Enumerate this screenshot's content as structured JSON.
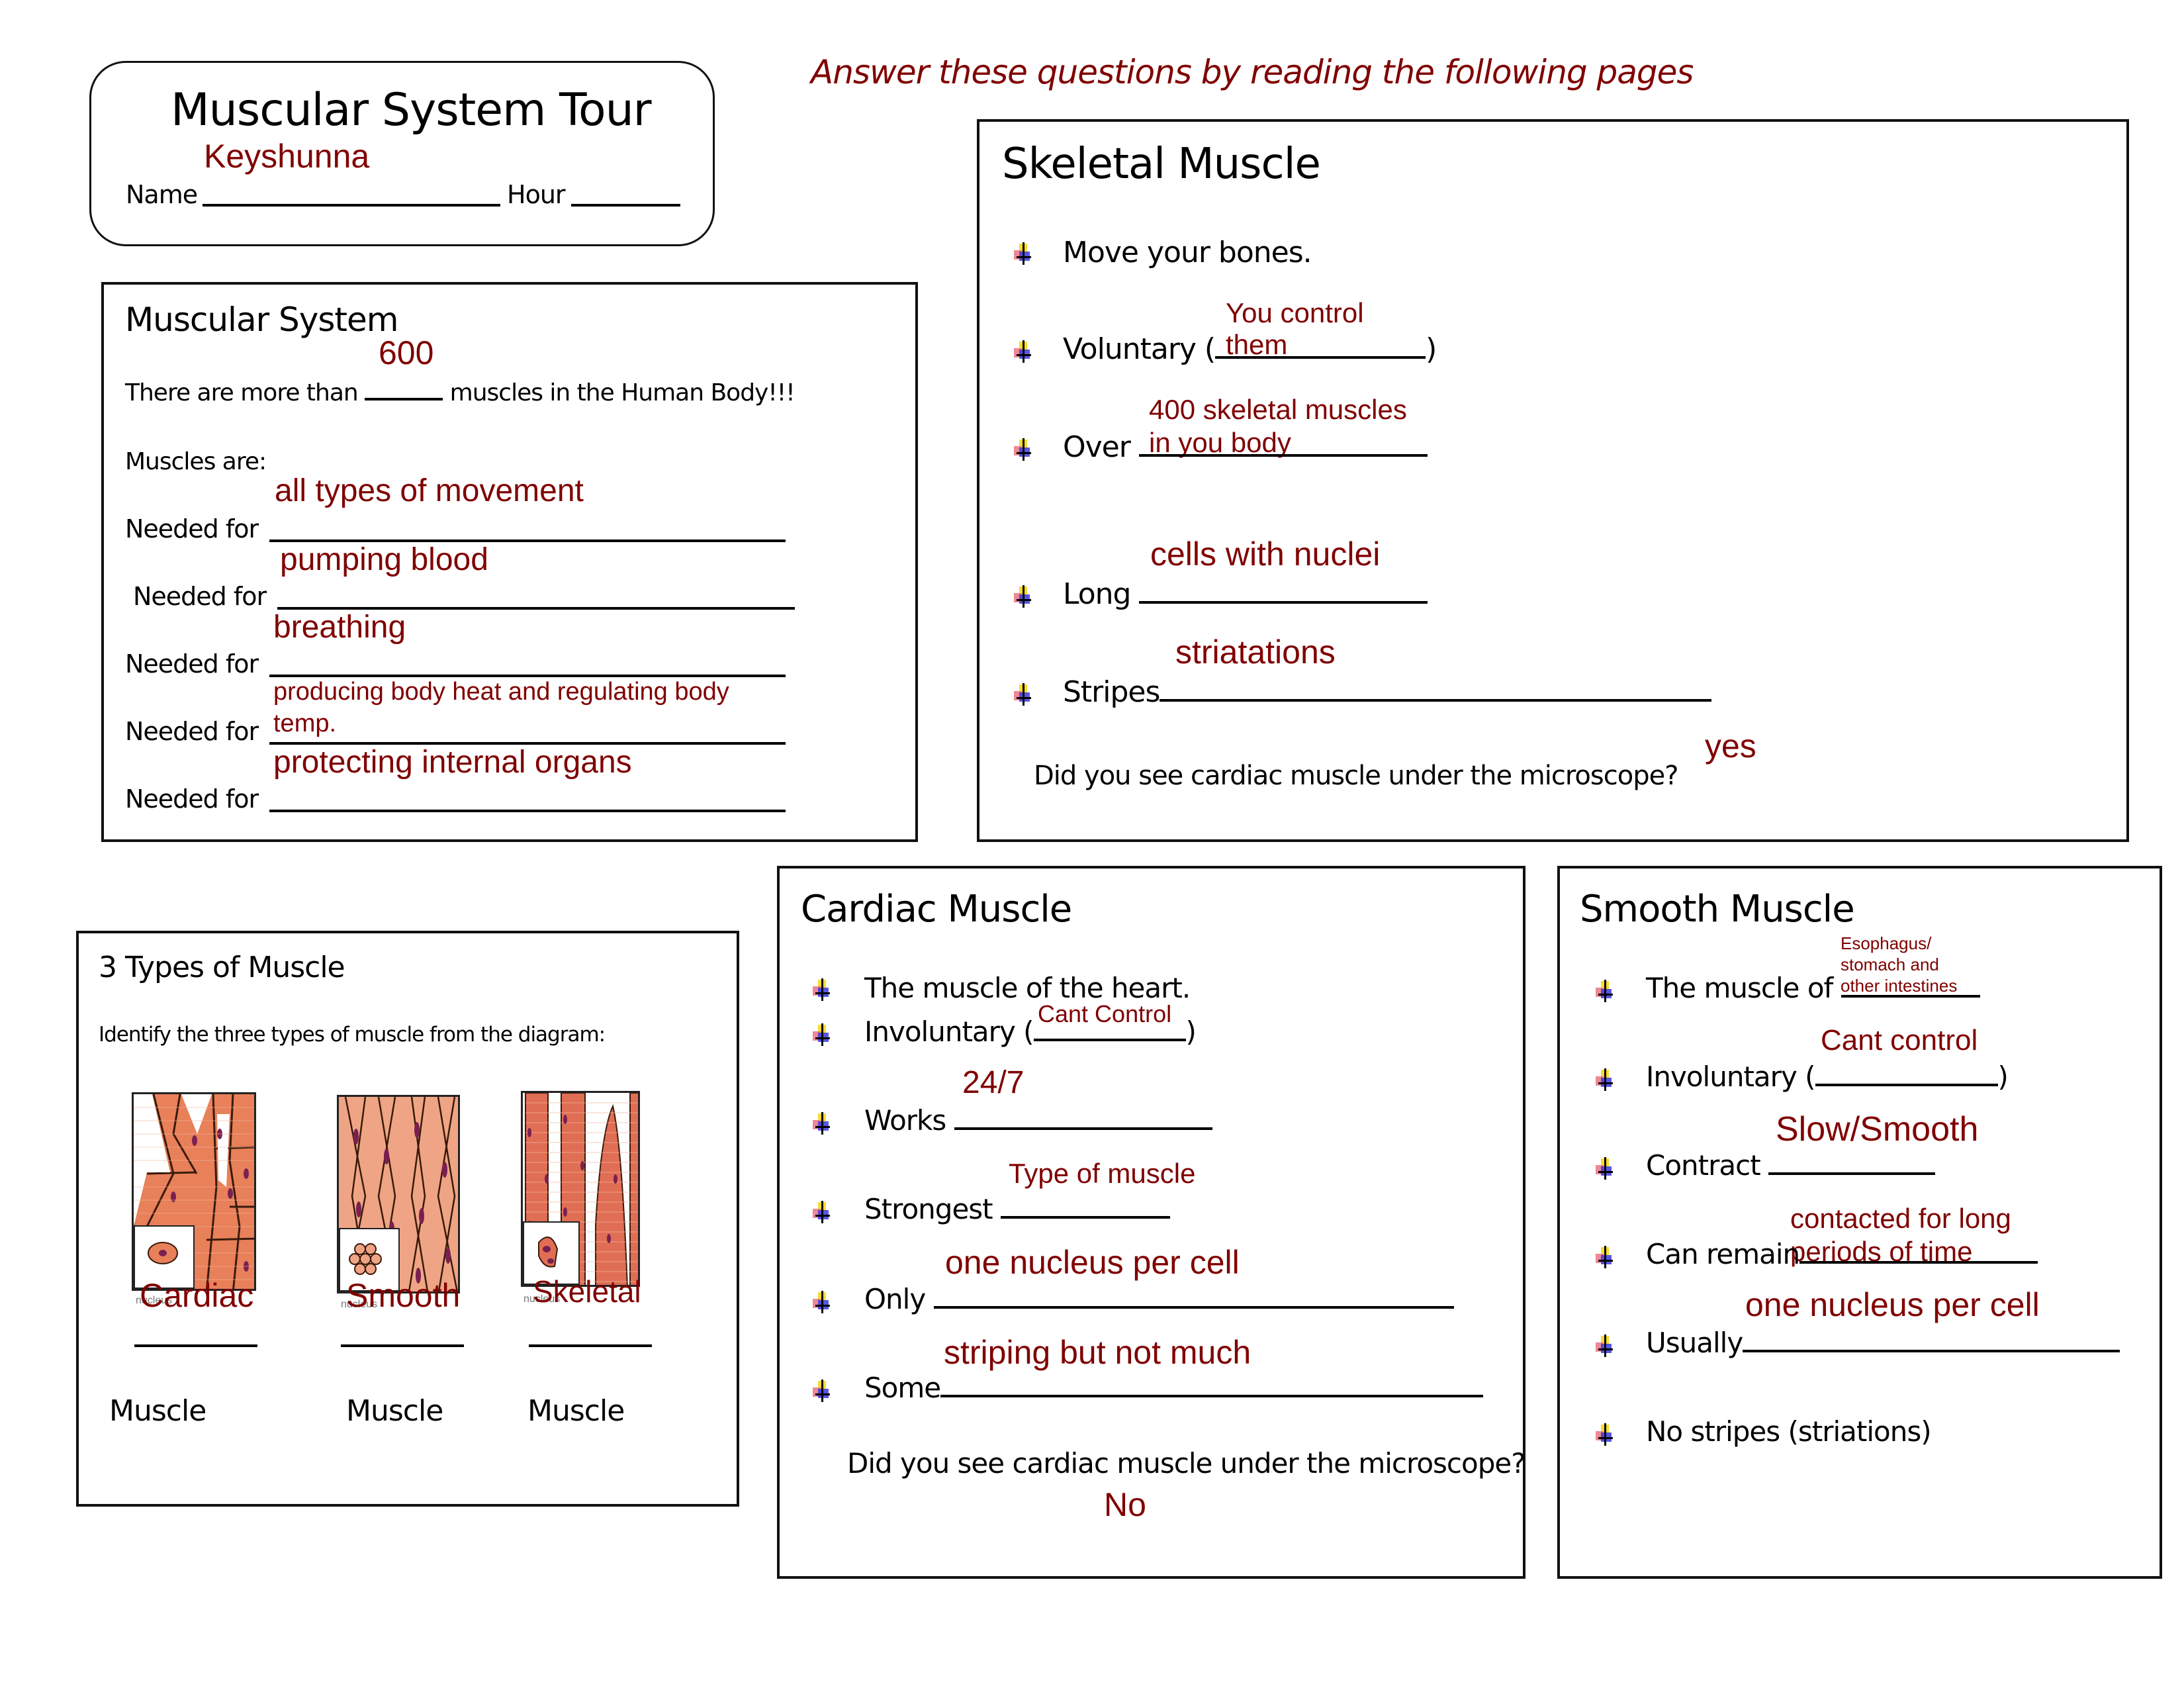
{
  "header": {
    "instruction": "Answer these questions by reading the following pages"
  },
  "title_box": {
    "title": "Muscular System Tour",
    "name_label": "Name",
    "name_value": "Keyshunna",
    "hour_label": "Hour",
    "hour_value": ""
  },
  "muscular_system": {
    "heading": "Muscular System",
    "count_prefix": "There are more than",
    "count_suffix": "muscles in the Human Body!!!",
    "count_answer": "600",
    "muscles_are_label": "Muscles are:",
    "needed_for_label": "Needed for",
    "needed_for": [
      {
        "answer": "all types of movement"
      },
      {
        "answer": "pumping blood"
      },
      {
        "answer": "breathing"
      },
      {
        "answer_line1": "producing body heat and regulating body",
        "answer_line2": "temp."
      },
      {
        "answer": "protecting internal organs"
      }
    ]
  },
  "skeletal": {
    "heading": "Skeletal Muscle",
    "items": [
      {
        "label": "Move your bones."
      },
      {
        "label": "Voluntary (",
        "suffix": ")",
        "answer_line1": "You control",
        "answer_line2": "them"
      },
      {
        "label": "Over",
        "answer_line1": "400 skeletal muscles",
        "answer_line2": "in you body"
      },
      {
        "label": "Long",
        "answer": "cells with nuclei"
      },
      {
        "label": "Stripes",
        "answer": "striatations"
      }
    ],
    "question": "Did you see cardiac muscle under the microscope?",
    "question_answer": "yes"
  },
  "three_types": {
    "heading": "3 Types of Muscle",
    "instruction": "Identify the three types of muscle from the diagram:",
    "inset_label": "nucleus",
    "types": [
      {
        "answer": "Cardiac",
        "suffix": "Muscle",
        "tissue_color": "#e8805a"
      },
      {
        "answer": "Smooth",
        "suffix": "Muscle",
        "tissue_color": "#efa585"
      },
      {
        "answer": "Skeletal",
        "suffix": "Muscle",
        "tissue_color": "#e06e55"
      }
    ]
  },
  "cardiac": {
    "heading": "Cardiac Muscle",
    "items": [
      {
        "label": "The muscle of the heart."
      },
      {
        "label": "Involuntary (",
        "suffix": ")",
        "answer": "Cant Control"
      },
      {
        "label": "Works",
        "answer": "24/7"
      },
      {
        "label": "Strongest",
        "answer": "Type of muscle"
      },
      {
        "label": "Only",
        "answer": "one nucleus per cell"
      },
      {
        "label": "Some",
        "answer": "striping but not much"
      }
    ],
    "question": "Did you see cardiac muscle under the microscope?",
    "question_answer": "No"
  },
  "smooth": {
    "heading": "Smooth Muscle",
    "items": [
      {
        "label": "The muscle of",
        "answer_line1": "Esophagus/",
        "answer_line2": "stomach and",
        "answer_line3": "other intestines"
      },
      {
        "label": "Involuntary (",
        "suffix": ")",
        "answer": "Cant control"
      },
      {
        "label": "Contract",
        "answer": "Slow/Smooth"
      },
      {
        "label": "Can remain",
        "answer_line1": "contacted for long",
        "answer_line2": "periods of time"
      },
      {
        "label": "Usually",
        "answer": "one nucleus per cell"
      },
      {
        "label": "No stripes (striations)"
      }
    ]
  },
  "colors": {
    "answer_text": "#800000",
    "border": "#111111",
    "bullet_yellow": "#f7d81a",
    "bullet_blue": "#3a3ae0",
    "bullet_red": "#e86a7a"
  }
}
